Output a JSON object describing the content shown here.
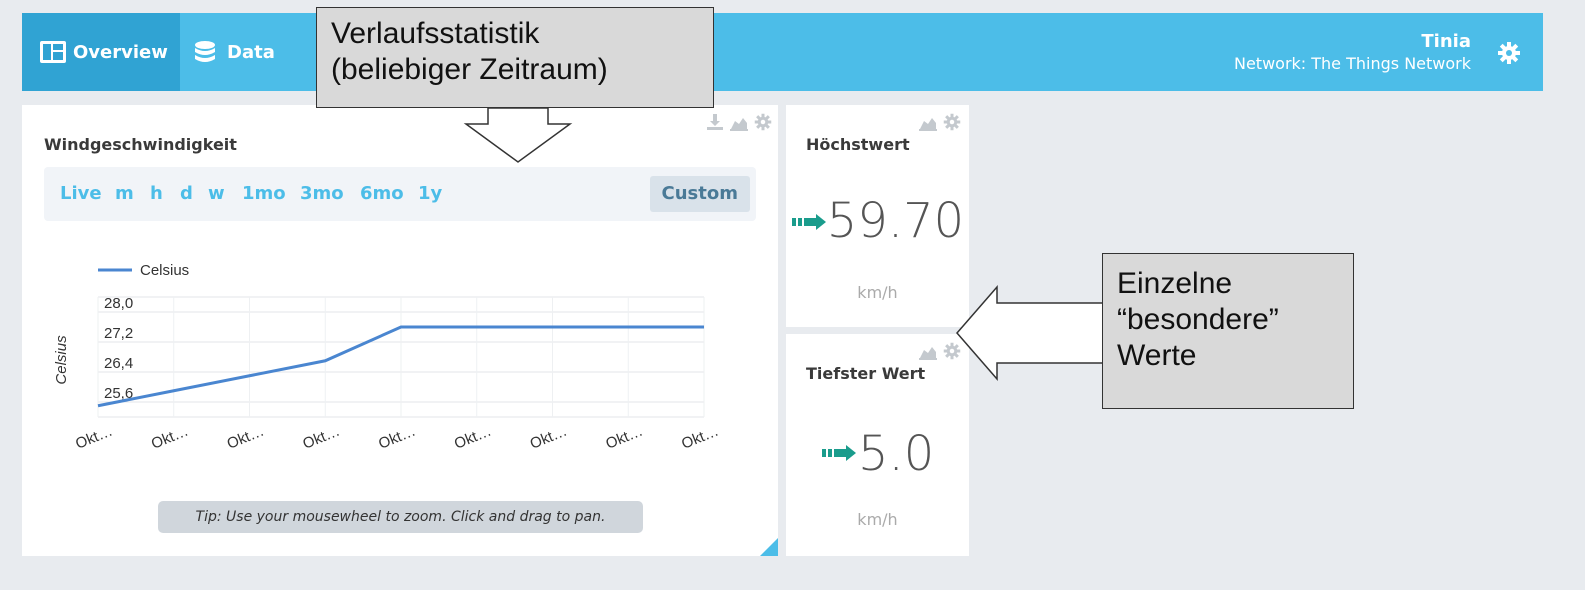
{
  "header": {
    "tabs": [
      {
        "label": "Overview",
        "icon": "dashboard-icon"
      },
      {
        "label": "Data",
        "icon": "database-icon"
      }
    ],
    "user_name": "Tinia",
    "network": "Network: The Things Network"
  },
  "main_panel": {
    "title": "Windgeschwindigkeit",
    "ranges": [
      "Live",
      "m",
      "h",
      "d",
      "w",
      "1mo",
      "3mo",
      "6mo",
      "1y"
    ],
    "custom_label": "Custom",
    "tip": "Tip: Use your mousewheel to zoom. Click and drag to pan."
  },
  "high_panel": {
    "title": "Höchstwert",
    "value": "59.70",
    "unit": "km/h"
  },
  "low_panel": {
    "title": "Tiefster Wert",
    "value": "5.0",
    "unit": "km/h"
  },
  "callouts": {
    "history": [
      "Verlaufsstatistik",
      "(beliebiger Zeitraum)"
    ],
    "special": [
      "Einzelne",
      "“besondere”",
      "Werte"
    ]
  },
  "colors": {
    "header_bg": "#4cbde8",
    "active_tab_bg": "#30a3d3",
    "arrow_green": "#1a9c8c",
    "line": "#4a86d0"
  },
  "chart_data": {
    "type": "line",
    "legend": [
      "Celsius"
    ],
    "ylabel": "Celsius",
    "yticks": [
      "28,0",
      "27,2",
      "26,4",
      "25,6"
    ],
    "ytick_values": [
      28.0,
      27.2,
      26.4,
      25.6
    ],
    "xticks": [
      "Okt…",
      "Okt…",
      "Okt…",
      "Okt…",
      "Okt…",
      "Okt…",
      "Okt…",
      "Okt…",
      "Okt…"
    ],
    "ylim": [
      25.2,
      28.4
    ],
    "series": [
      {
        "name": "Celsius",
        "values": [
          25.5,
          25.9,
          26.3,
          26.7,
          27.6,
          27.6,
          27.6,
          27.6,
          27.6
        ]
      }
    ]
  }
}
